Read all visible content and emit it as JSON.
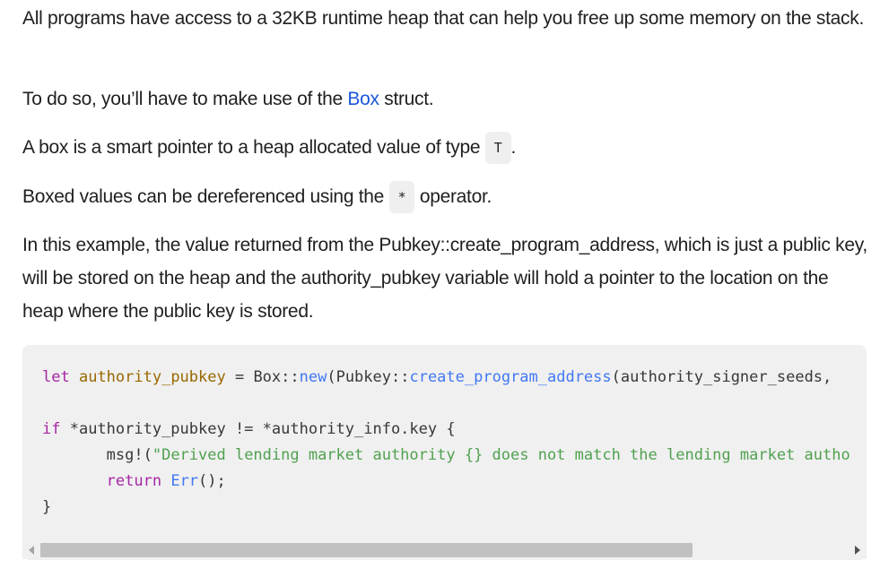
{
  "paragraphs": {
    "p1": "All programs have access to a 32KB runtime heap that can help you free up some memory on the stack.",
    "p2_before": "To do so, you’ll have to make use of the ",
    "p2_link": "Box",
    "p2_after": " struct.",
    "p3_before": "A box is a smart pointer to a heap allocated value of type ",
    "p3_code": "T",
    "p3_after": ".",
    "p4_before": "Boxed values can be dereferenced using the ",
    "p4_code": "*",
    "p4_after": " operator.",
    "p5": "In this example, the value returned from the Pubkey::create_program_address, which is just a public key, will be stored on the heap and the authority_pubkey variable will hold a pointer to the location on the heap where the public key is stored."
  },
  "code": {
    "l1_let": "let",
    "l1_var": "authority_pubkey",
    "l1_mid": " = Box::",
    "l1_new": "new",
    "l1_mid2": "(Pubkey::",
    "l1_fn": "create_program_address",
    "l1_rest": "(authority_signer_seeds,",
    "l2_if": "if",
    "l2_rest": " *authority_pubkey != *authority_info.key {",
    "l3_macro": "msg!(",
    "l3_str": "\"Derived lending market authority {} does not match the lending market autho",
    "l4_return": "return",
    "l4_err": "Err",
    "l4_rest": "();",
    "l5": "}"
  },
  "scroll": {
    "horizontal_position": 0.0,
    "visible_fraction": 0.79
  }
}
